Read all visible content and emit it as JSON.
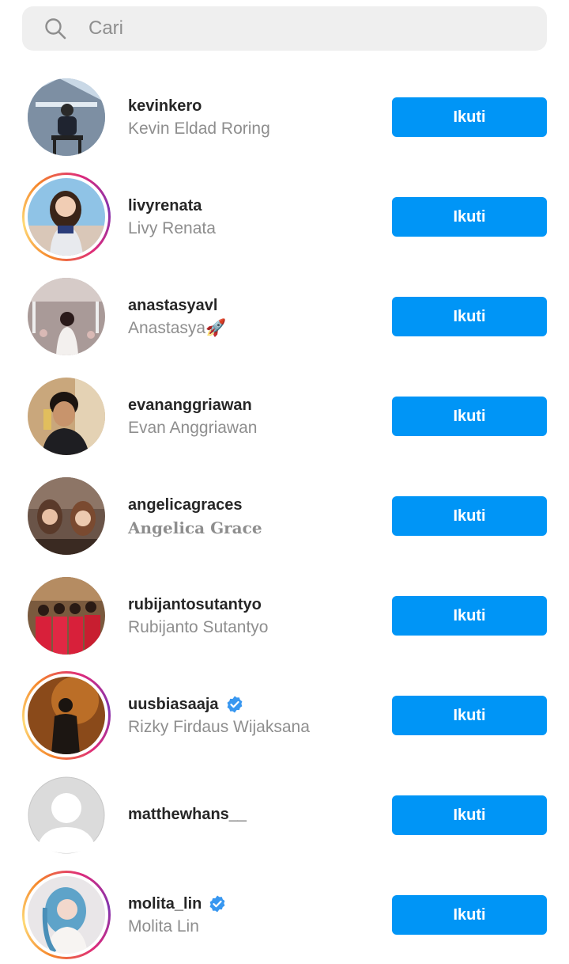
{
  "search": {
    "placeholder": "Cari",
    "icon": "search-icon"
  },
  "follow_label": "Ikuti",
  "colors": {
    "follow_button": "#0095f6",
    "verified_badge": "#3897f0",
    "secondary_text": "#8e8e8e"
  },
  "accounts": [
    {
      "username": "kevinkero",
      "full_name": "Kevin Eldad Roring",
      "verified": false,
      "story_ring": false
    },
    {
      "username": "livyrenata",
      "full_name": "Livy Renata",
      "verified": false,
      "story_ring": true
    },
    {
      "username": "anastasyavl",
      "full_name": "Anastasya🚀",
      "verified": false,
      "story_ring": false
    },
    {
      "username": "evananggriawan",
      "full_name": "Evan Anggriawan",
      "verified": false,
      "story_ring": false
    },
    {
      "username": "angelicagraces",
      "full_name": "Angelica Grace",
      "verified": false,
      "story_ring": false
    },
    {
      "username": "rubijantosutantyo",
      "full_name": "Rubijanto Sutantyo",
      "verified": false,
      "story_ring": false
    },
    {
      "username": "uusbiasaaja",
      "full_name": "Rizky Firdaus Wijaksana",
      "verified": true,
      "story_ring": true
    },
    {
      "username": "matthewhans__",
      "full_name": "",
      "verified": false,
      "story_ring": false
    },
    {
      "username": "molita_lin",
      "full_name": "Molita Lin",
      "verified": true,
      "story_ring": true
    }
  ]
}
